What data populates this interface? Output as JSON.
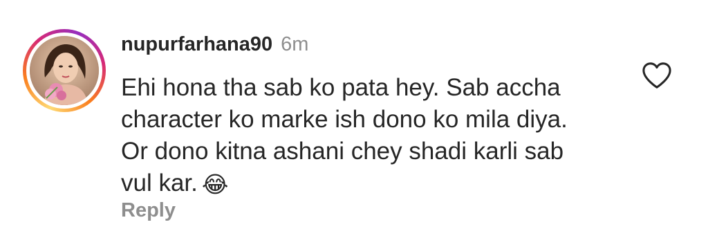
{
  "comment": {
    "username": "nupurfarhana90",
    "time": "6m",
    "text_lines": [
      "Ehi hona tha sab ko pata hey. Sab accha",
      "character ko marke ish dono ko mila diya.",
      "Or dono kitna ashani chey shadi karli sab",
      "vul kar."
    ],
    "emoji": "😂",
    "reply_label": "Reply",
    "like_icon": "heart-outline-icon",
    "avatar_icon": "user-avatar-photo"
  },
  "colors": {
    "text": "#262626",
    "secondary": "#8e8e8e",
    "story_ring": [
      "#feda75",
      "#fa7e1e",
      "#d62976",
      "#962fbf"
    ]
  }
}
